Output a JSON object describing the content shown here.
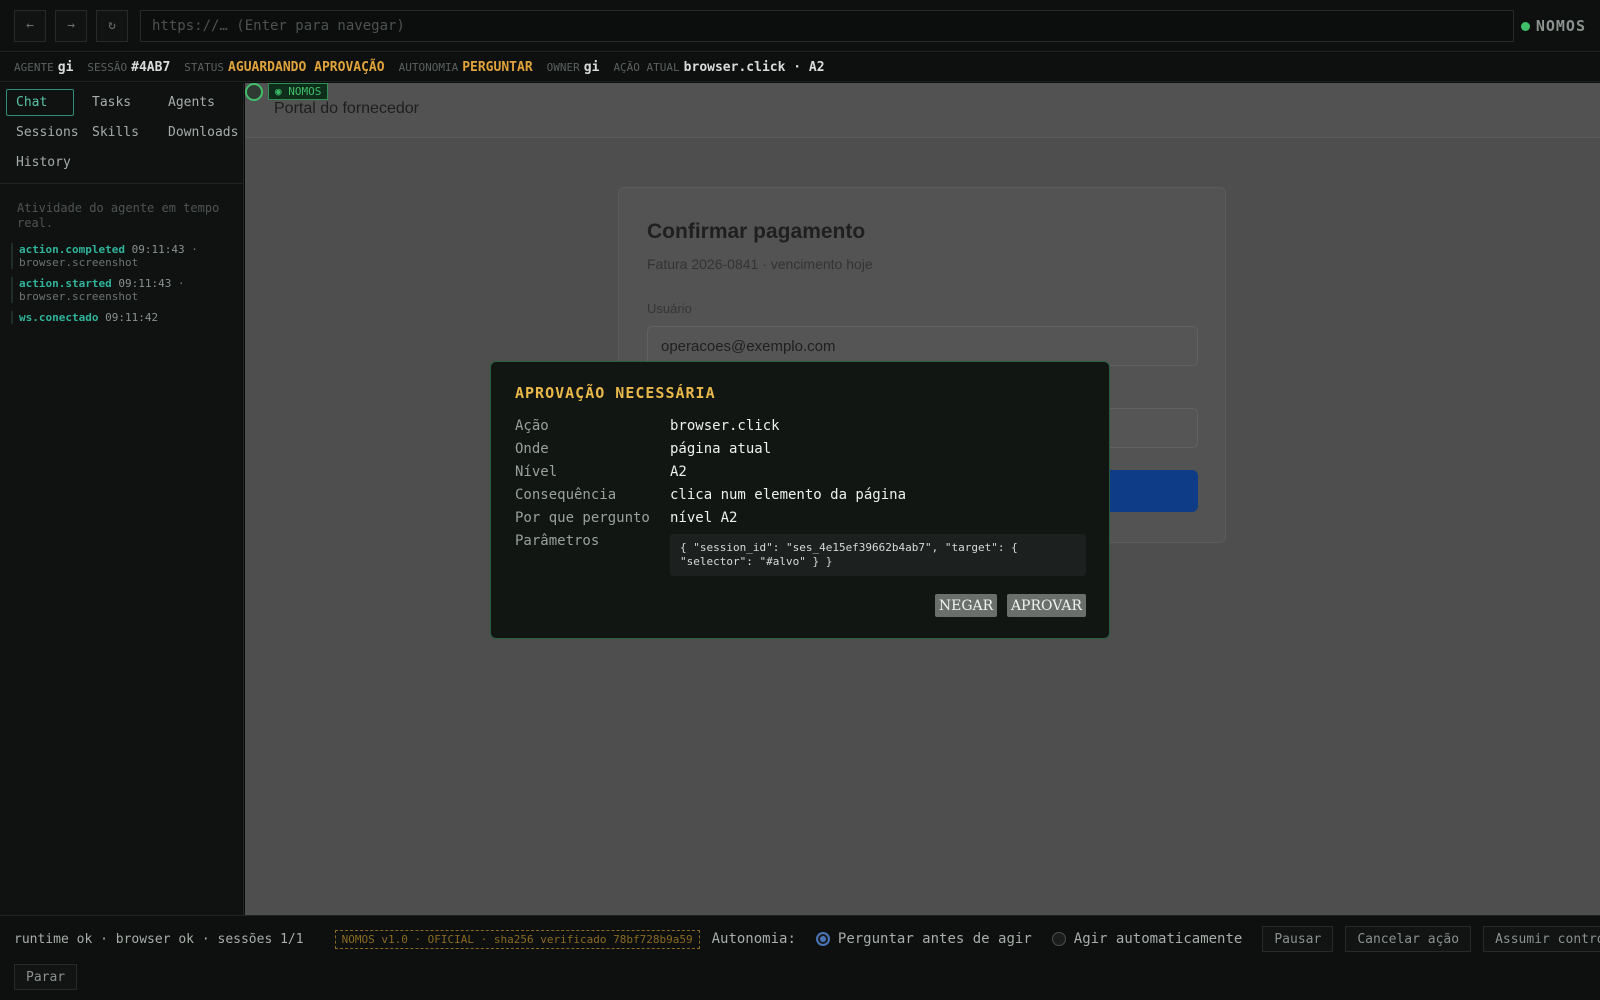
{
  "topbar": {
    "back_label": "←",
    "forward_label": "→",
    "reload_label": "↻",
    "url_placeholder": "https://…  (Enter para navegar)",
    "brand": "NOMOS",
    "brand_status_color": "#3fbf6a"
  },
  "status": {
    "agent_key": "AGENTE",
    "agent_val": "gi",
    "session_key": "SESSÃO",
    "session_val": "#4AB7",
    "status_key": "STATUS",
    "status_val": "AGUARDANDO APROVAÇÃO",
    "autonomy_key": "AUTONOMIA",
    "autonomy_val": "PERGUNTAR",
    "owner_key": "OWNER",
    "owner_val": "gi",
    "action_key": "AÇÃO ATUAL",
    "action_val": "browser.click · A2"
  },
  "sidebar": {
    "tabs": [
      "Chat",
      "Tasks",
      "Agents",
      "Sessions",
      "Skills",
      "Downloads",
      "History"
    ],
    "active_tab": "Chat",
    "feed_hint": "Atividade do agente em tempo real.",
    "events": [
      {
        "type": "action.completed",
        "time": "09:11:43",
        "detail": "browser.screenshot"
      },
      {
        "type": "action.started",
        "time": "09:11:43",
        "detail": "browser.screenshot"
      },
      {
        "type": "ws.conectado",
        "time": "09:11:42",
        "detail": ""
      }
    ]
  },
  "page": {
    "badge": "◉ NOMOS",
    "portal_title": "Portal do fornecedor",
    "card_title": "Confirmar pagamento",
    "card_subtitle": "Fatura 2026-0841 · vencimento hoje",
    "user_label": "Usuário",
    "user_value": "operacoes@exemplo.com"
  },
  "modal": {
    "title": "APROVAÇÃO NECESSÁRIA",
    "rows": [
      {
        "k": "Ação",
        "v": "browser.click"
      },
      {
        "k": "Onde",
        "v": "página atual"
      },
      {
        "k": "Nível",
        "v": "A2"
      },
      {
        "k": "Consequência",
        "v": "clica num elemento da página"
      },
      {
        "k": "Por que pergunto",
        "v": "nível A2"
      },
      {
        "k": "Parâmetros",
        "v": ""
      }
    ],
    "params": "{ \"session_id\": \"ses_4e15ef39662b4ab7\", \"target\": { \"selector\": \"#alvo\" } }",
    "deny_label": "NEGAR",
    "approve_label": "APROVAR"
  },
  "bottom": {
    "runtime": "runtime ok · browser ok · sessões 1/1",
    "version": "NOMOS v1.0 · OFICIAL · sha256 verificado 78bf728b9a59",
    "autonomy_label": "Autonomia:",
    "opt_ask": "Perguntar antes de agir",
    "opt_auto": "Agir automaticamente",
    "selected_option": "Perguntar antes de agir",
    "pause_label": "Pausar",
    "cancel_label": "Cancelar ação",
    "takeover_label": "Assumir controle",
    "stop_label": "Parar"
  }
}
